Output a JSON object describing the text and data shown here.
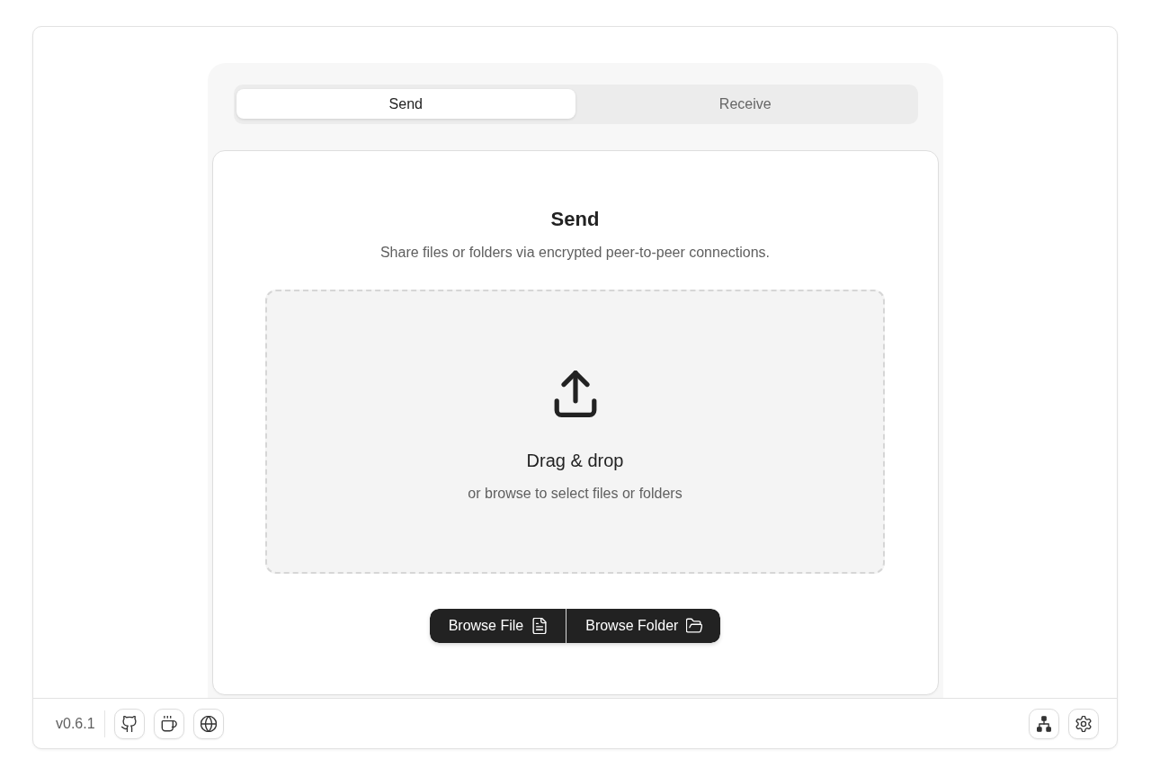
{
  "tabs": [
    {
      "label": "Send",
      "selected": true
    },
    {
      "label": "Receive",
      "selected": false
    }
  ],
  "panel": {
    "title": "Send",
    "subtitle": "Share files or folders via encrypted peer-to-peer connections.",
    "dropzone": {
      "title": "Drag & drop",
      "hint": "or browse to select files or folders"
    },
    "buttons": [
      {
        "label": "Browse File",
        "kind": "file"
      },
      {
        "label": "Browse Folder",
        "kind": "folder"
      }
    ]
  },
  "footer": {
    "version": "v0.6.1",
    "links": [
      {
        "kind": "github"
      },
      {
        "kind": "coffee"
      },
      {
        "kind": "globe"
      }
    ],
    "actions": [
      {
        "kind": "network"
      },
      {
        "kind": "settings"
      }
    ]
  }
}
